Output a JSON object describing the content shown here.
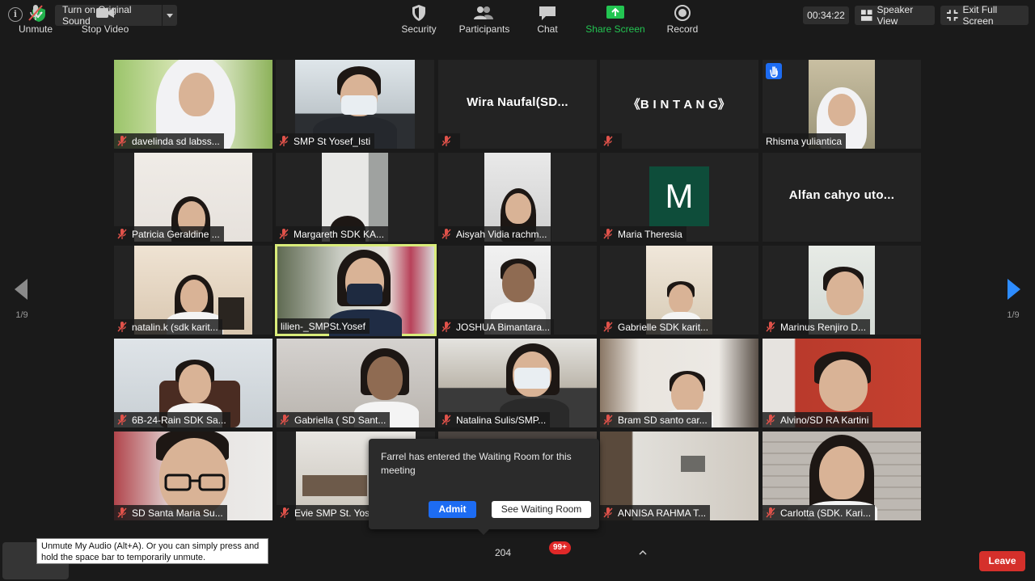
{
  "topbar": {
    "original_sound_label": "Turn on Original Sound",
    "timer": "00:34:22",
    "speaker_view_label": "Speaker View",
    "exit_fullscreen_label": "Exit Full Screen"
  },
  "pager": {
    "left_page": "1/9",
    "right_page": "1/9"
  },
  "participants": [
    {
      "name": "davelinda sd labss...",
      "muted": true
    },
    {
      "name": "SMP St Yosef_Isti",
      "muted": true
    },
    {
      "name": "",
      "display_name": "Wira  Naufal(SD...",
      "muted": true
    },
    {
      "name": "",
      "display_name": "《B I N T A N G》",
      "muted": true
    },
    {
      "name": "Rhisma yuliantica",
      "muted": false,
      "hand_raised": true
    },
    {
      "name": "Patricia Geraldine ...",
      "muted": true
    },
    {
      "name": "Margareth SDK KA...",
      "muted": true
    },
    {
      "name": "Aisyah Vidia rachm...",
      "muted": true
    },
    {
      "name": "Maria Theresia",
      "muted": true,
      "avatar_letter": "M"
    },
    {
      "name": "",
      "display_name": "Alfan cahyo uto...",
      "muted": false
    },
    {
      "name": "natalin.k (sdk karit...",
      "muted": true
    },
    {
      "name": "lilien-_SMPSt.Yosef",
      "muted": false,
      "active_speaker": true
    },
    {
      "name": "JOSHUA Bimantara...",
      "muted": true
    },
    {
      "name": "Gabrielle SDK karit...",
      "muted": true
    },
    {
      "name": "Marinus Renjiro D...",
      "muted": true
    },
    {
      "name": "6B-24-Rain SDK Sa...",
      "muted": true
    },
    {
      "name": "Gabriella ( SD Sant...",
      "muted": true
    },
    {
      "name": "Natalina Sulis/SMP...",
      "muted": true
    },
    {
      "name": "Bram SD santo car...",
      "muted": true
    },
    {
      "name": "Alvino/SD RA Kartini",
      "muted": true
    },
    {
      "name": "SD Santa Maria Su...",
      "muted": true
    },
    {
      "name": "Evie SMP St. Yos",
      "muted": true
    },
    {
      "name": "",
      "muted": false
    },
    {
      "name": "ANNISA RAHMA T...",
      "muted": true
    },
    {
      "name": "Carlotta (SDK. Kari...",
      "muted": true
    }
  ],
  "waiting_room": {
    "message": "Farrel has entered the Waiting Room for this meeting",
    "admit_label": "Admit",
    "see_waiting_room_label": "See Waiting Room"
  },
  "tooltip": "Unmute My Audio (Alt+A). Or you can simply press and hold the space bar to temporarily unmute.",
  "toolbar": {
    "unmute_label": "Unmute",
    "stop_video_label": "Stop Video",
    "security_label": "Security",
    "participants_label": "Participants",
    "participants_count": "204",
    "chat_label": "Chat",
    "chat_badge": "99+",
    "share_screen_label": "Share Screen",
    "record_label": "Record",
    "leave_label": "Leave"
  },
  "colors": {
    "active_speaker_border": "#d9ec7a",
    "admit_blue": "#1d6cf2",
    "share_green": "#23c552",
    "leave_red": "#d5302b",
    "mute_red": "#e0524a",
    "avatar_green": "#0e4d3a"
  }
}
